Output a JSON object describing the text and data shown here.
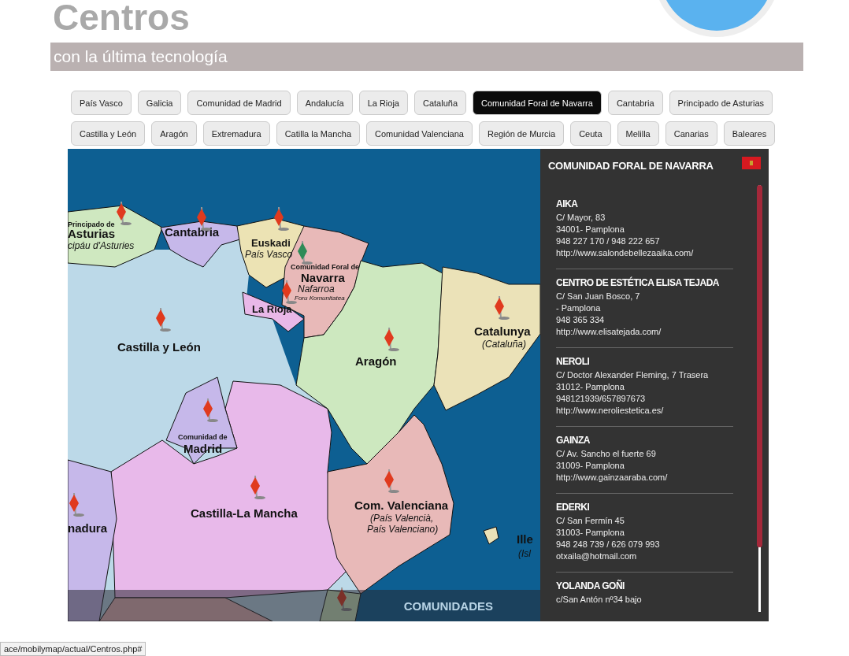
{
  "header": {
    "title": "Centros",
    "subtitle": "con la última tecnología"
  },
  "tabs": [
    {
      "label": "País Vasco",
      "selected": false
    },
    {
      "label": "Galicia",
      "selected": false
    },
    {
      "label": "Comunidad de Madrid",
      "selected": false
    },
    {
      "label": "Andalucía",
      "selected": false
    },
    {
      "label": "La Rioja",
      "selected": false
    },
    {
      "label": "Cataluña",
      "selected": false
    },
    {
      "label": "Comunidad Foral de Navarra",
      "selected": true
    },
    {
      "label": "Cantabria",
      "selected": false
    },
    {
      "label": "Principado de Asturias",
      "selected": false
    },
    {
      "label": "Castilla y León",
      "selected": false
    },
    {
      "label": "Aragón",
      "selected": false
    },
    {
      "label": "Extremadura",
      "selected": false
    },
    {
      "label": "Catilla la Mancha",
      "selected": false
    },
    {
      "label": "Comunidad Valenciana",
      "selected": false
    },
    {
      "label": "Región de Murcia",
      "selected": false
    },
    {
      "label": "Ceuta",
      "selected": false
    },
    {
      "label": "Melilla",
      "selected": false
    },
    {
      "label": "Canarias",
      "selected": false
    },
    {
      "label": "Baleares",
      "selected": false
    }
  ],
  "map": {
    "labels": [
      {
        "text": "Principado de",
        "kind": "small"
      },
      {
        "text": "Asturias",
        "kind": "big"
      },
      {
        "text": "cipáu d'Asturies",
        "kind": "italic"
      },
      {
        "text": "Cantabria",
        "kind": "big"
      },
      {
        "text": "Euskadi",
        "kind": "mid"
      },
      {
        "text": "País Vasco",
        "kind": "italic"
      },
      {
        "text": "Comunidad Foral de",
        "kind": "small"
      },
      {
        "text": "Navarra",
        "kind": "big"
      },
      {
        "text": "Nafarroa",
        "kind": "italic"
      },
      {
        "text": "Foru Komunitatea",
        "kind": "tiny"
      },
      {
        "text": "La Rioja",
        "kind": "mid"
      },
      {
        "text": "Castilla y León",
        "kind": "big"
      },
      {
        "text": "Aragón",
        "kind": "big"
      },
      {
        "text": "Catalunya",
        "kind": "big"
      },
      {
        "text": "(Cataluña)",
        "kind": "italic"
      },
      {
        "text": "Comunidad de",
        "kind": "small"
      },
      {
        "text": "Madrid",
        "kind": "big"
      },
      {
        "text": "Castilla-La Mancha",
        "kind": "big"
      },
      {
        "text": "nadura",
        "kind": "big"
      },
      {
        "text": "Com. Valenciana",
        "kind": "big"
      },
      {
        "text": "(País Valencià,",
        "kind": "italic"
      },
      {
        "text": "País Valenciano)",
        "kind": "italic"
      },
      {
        "text": "Ille",
        "kind": "big"
      },
      {
        "text": "(Isl",
        "kind": "italic"
      }
    ],
    "pins": [
      {
        "selected": false
      },
      {
        "selected": false
      },
      {
        "selected": false
      },
      {
        "selected": true
      },
      {
        "selected": false
      },
      {
        "selected": false
      },
      {
        "selected": false
      },
      {
        "selected": false
      },
      {
        "selected": false
      },
      {
        "selected": false
      },
      {
        "selected": false
      },
      {
        "selected": false
      },
      {
        "selected": false
      }
    ],
    "bar_label": "COMUNIDADES"
  },
  "panel": {
    "title": "COMUNIDAD FORAL DE NAVARRA",
    "centers": [
      {
        "name": "AIKA",
        "lines": [
          "C/ Mayor, 83",
          "34001- Pamplona",
          "948 227 170 / 948 222 657",
          "http://www.salondebellezaaika.com/"
        ]
      },
      {
        "name": "CENTRO DE ESTÉTICA ELISA TEJADA",
        "lines": [
          "C/ San Juan Bosco, 7",
          "- Pamplona",
          "948 365 334",
          "http://www.elisatejada.com/"
        ]
      },
      {
        "name": "NEROLI",
        "lines": [
          "C/ Doctor Alexander Fleming, 7 Trasera",
          "31012- Pamplona",
          "948121939/657897673",
          "http://www.neroliestetica.es/"
        ]
      },
      {
        "name": "GAINZA",
        "lines": [
          "C/ Av. Sancho el fuerte 69",
          "31009- Pamplona",
          "http://www.gainzaaraba.com/"
        ]
      },
      {
        "name": "EDERKI",
        "lines": [
          "C/ San Fermín 45",
          "31003- Pamplona",
          "948 248 739 / 626 079 993",
          "otxaila@hotmail.com"
        ]
      },
      {
        "name": "YOLANDA GOÑI",
        "lines": [
          "c/San Antón nº34 bajo"
        ]
      }
    ]
  },
  "status_bar": {
    "url": "ace/mobilymap/actual/Centros.php#"
  }
}
